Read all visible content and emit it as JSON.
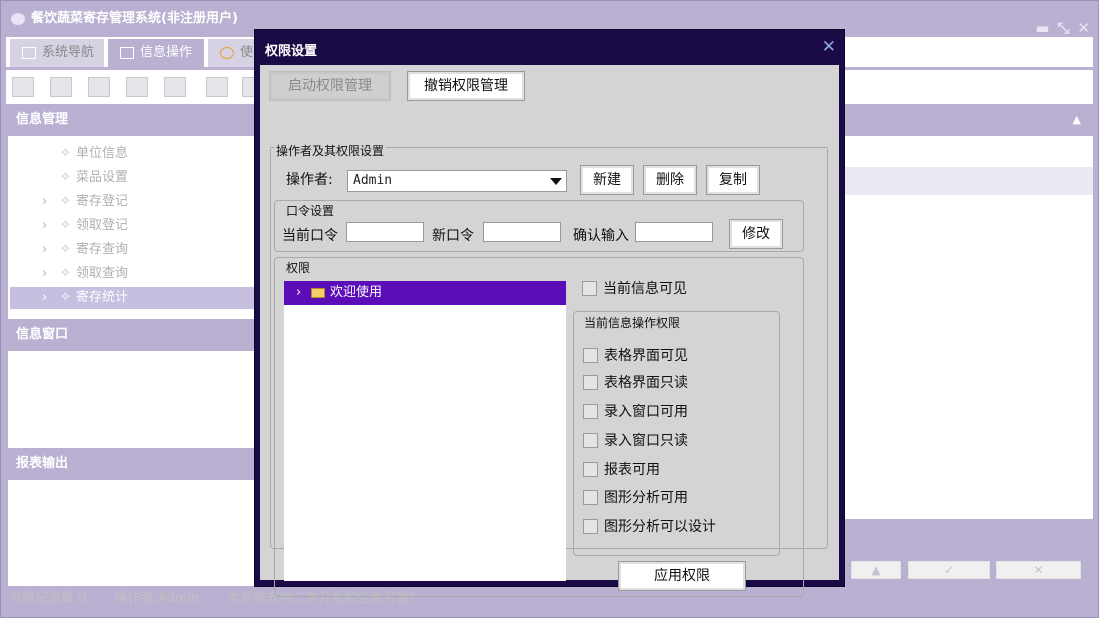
{
  "app": {
    "title": "餐饮蔬菜寄存管理系统(非注册用户)"
  },
  "tabs": [
    {
      "label": "系统导航"
    },
    {
      "label": "信息操作"
    },
    {
      "label": "使"
    }
  ],
  "left": {
    "info_mgmt": {
      "title": "信息管理",
      "items": [
        "单位信息",
        "菜品设置",
        "寄存登记",
        "领取登记",
        "寄存查询",
        "领取查询",
        "寄存统计"
      ]
    },
    "info_window": {
      "title": "信息窗口"
    },
    "report": {
      "title": "报表输出"
    }
  },
  "status": {
    "records": "当前记录数 0",
    "operator": "操作者:Admin",
    "note": "本系统支持二次开发和全新开发!"
  },
  "dialog": {
    "title": "权限设置",
    "btn_start": "启动权限管理",
    "btn_revoke": "撤销权限管理",
    "ops_group": "操作者及其权限设置",
    "operator_label": "操作者:",
    "operator_value": "Admin",
    "btn_new": "新建",
    "btn_delete": "删除",
    "btn_copy": "复制",
    "pwd_group": "口令设置",
    "pwd_current": "当前口令",
    "pwd_new": "新口令",
    "pwd_confirm": "确认输入",
    "btn_modify": "修改",
    "perm_group": "权限",
    "tree_item": "欢迎使用",
    "chk_visible": "当前信息可见",
    "op_group": "当前信息操作权限",
    "op_items": [
      "表格界面可见",
      "表格界面只读",
      "录入窗口可用",
      "录入窗口只读",
      "报表可用",
      "图形分析可用",
      "图形分析可以设计"
    ],
    "btn_apply": "应用权限"
  }
}
